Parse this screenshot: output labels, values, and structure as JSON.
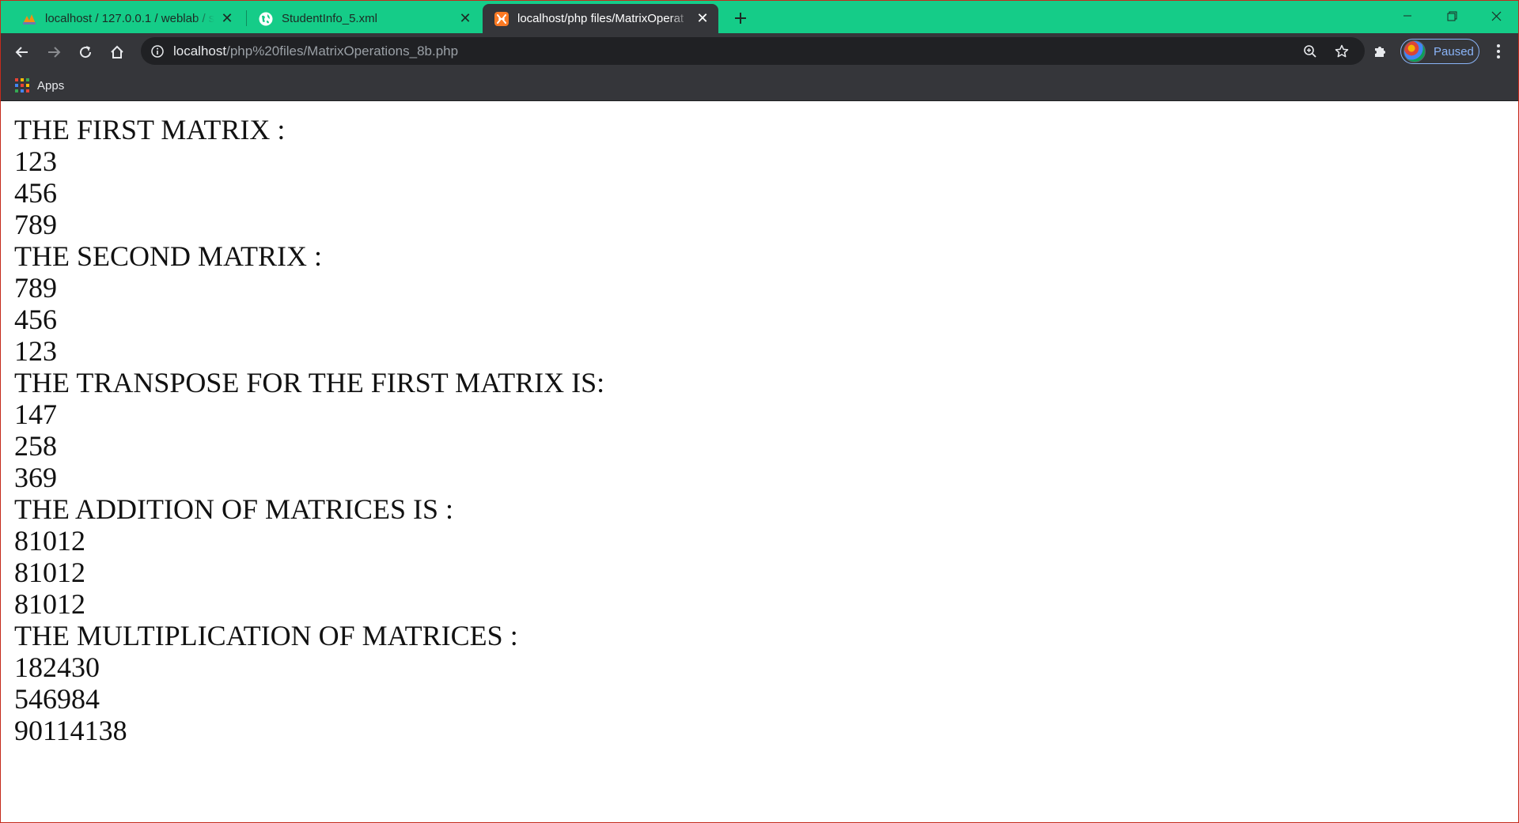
{
  "browser": {
    "tabs": [
      {
        "title": "localhost / 127.0.0.1 / weblab / st",
        "favicon": "phpmyadmin-icon",
        "active": false
      },
      {
        "title": "StudentInfo_5.xml",
        "favicon": "globe-icon",
        "active": false
      },
      {
        "title": "localhost/php files/MatrixOperat",
        "favicon": "xampp-icon",
        "active": true
      }
    ],
    "address": {
      "host": "localhost",
      "path": "/php%20files/MatrixOperations_8b.php"
    },
    "profile_label": "Paused",
    "bookmarks": [
      {
        "label": "Apps",
        "icon": "apps-grid-icon"
      }
    ],
    "colors": {
      "tabstrip": "#15cc88",
      "toolbar": "#35363a",
      "omnibox": "#202124",
      "profile_accent": "#8ab4f8"
    }
  },
  "page": {
    "lines": [
      "THE FIRST MATRIX :",
      "123",
      "456",
      "789",
      "THE SECOND MATRIX :",
      "789",
      "456",
      "123",
      "THE TRANSPOSE FOR THE FIRST MATRIX IS:",
      "147",
      "258",
      "369",
      "THE ADDITION OF MATRICES IS :",
      "81012",
      "81012",
      "81012",
      "THE MULTIPLICATION OF MATRICES :",
      "182430",
      "546984",
      "90114138"
    ]
  }
}
